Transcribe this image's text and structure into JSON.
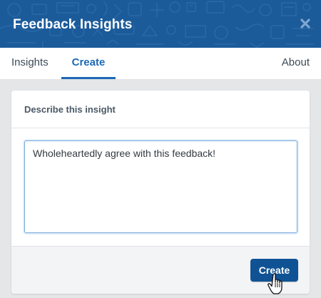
{
  "header": {
    "title": "Feedback Insights",
    "close_icon": "close-icon",
    "background_color": "#1c5b9a"
  },
  "tabs": [
    {
      "label": "Insights",
      "active": false
    },
    {
      "label": "Create",
      "active": true
    },
    {
      "label": "About",
      "active": false
    }
  ],
  "form": {
    "section_title": "Describe this insight",
    "textarea_value": "Wholeheartedly agree with this feedback!",
    "submit_label": "Create"
  },
  "colors": {
    "accent": "#1d69b4",
    "button": "#105394"
  }
}
